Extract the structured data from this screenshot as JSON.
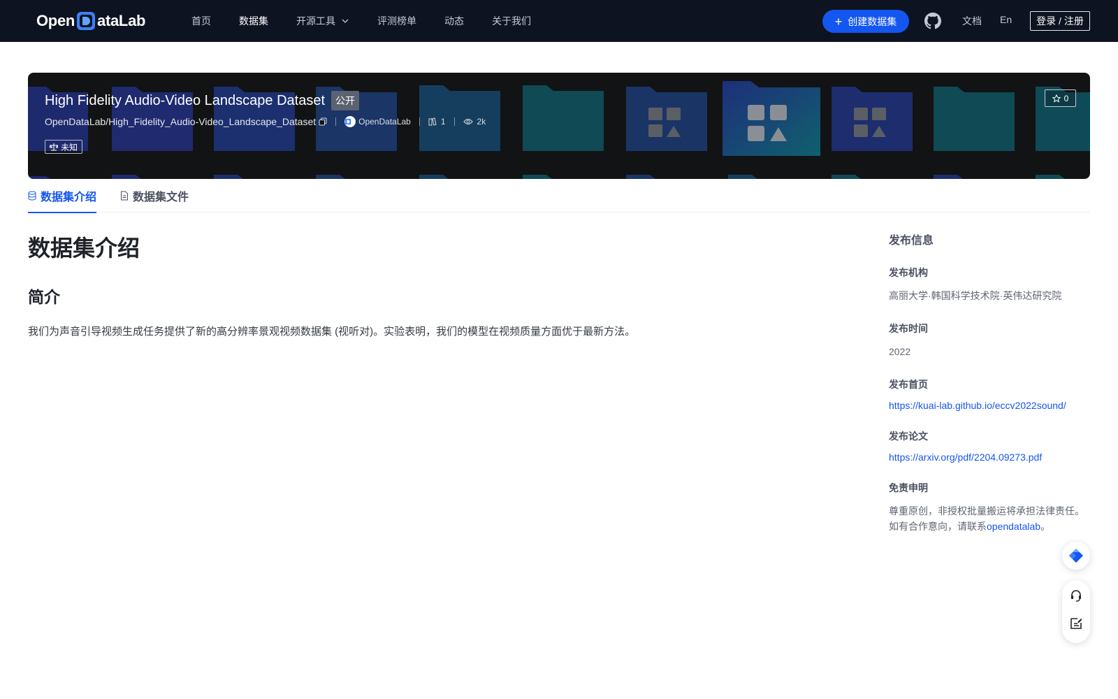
{
  "nav": {
    "logo": {
      "left": "Open",
      "right": "ataLab"
    },
    "links": [
      {
        "label": "首页",
        "active": false
      },
      {
        "label": "数据集",
        "active": true
      },
      {
        "label": "开源工具",
        "active": false,
        "dropdown": true
      },
      {
        "label": "评测榜单",
        "active": false
      },
      {
        "label": "动态",
        "active": false
      },
      {
        "label": "关于我们",
        "active": false
      }
    ],
    "create_label": "创建数据集",
    "docs_label": "文档",
    "lang_label": "En",
    "login_label": "登录 / 注册"
  },
  "dataset": {
    "title": "High Fidelity Audio-Video Landscape Dataset",
    "visibility": "公开",
    "path": "OpenDataLab/High_Fidelity_Audio-Video_Landscape_Dataset",
    "org": "OpenDataLab",
    "file_count": "1",
    "views": "2k",
    "license": "未知",
    "stars": "0"
  },
  "tabs": [
    {
      "label": "数据集介绍",
      "active": true,
      "icon": "database-icon"
    },
    {
      "label": "数据集文件",
      "active": false,
      "icon": "file-icon"
    }
  ],
  "content": {
    "heading": "数据集介绍",
    "subheading": "简介",
    "paragraph": "我们为声音引导视频生成任务提供了新的高分辨率景观视频数据集 (视听对)。实验表明，我们的模型在视频质量方面优于最新方法。"
  },
  "sidebar": {
    "title": "发布信息",
    "org_label": "发布机构",
    "org_value": "高丽大学·韩国科学技术院·英伟达研究院",
    "time_label": "发布时间",
    "time_value": "2022",
    "home_label": "发布首页",
    "home_url": "https://kuai-lab.github.io/eccv2022sound/",
    "paper_label": "发布论文",
    "paper_url": "https://arxiv.org/pdf/2204.09273.pdf",
    "disclaimer_label": "免责申明",
    "disclaimer_line1": "尊重原创，非授权批量搬运将承担法律责任。",
    "disclaimer_line2_prefix": "如有合作意向，请联系",
    "disclaimer_contact": "opendatalab",
    "disclaimer_line2_suffix": "。"
  },
  "colors": {
    "nav_bg": "#0d1321",
    "primary": "#1456f0",
    "banner_bg": "#121314"
  }
}
